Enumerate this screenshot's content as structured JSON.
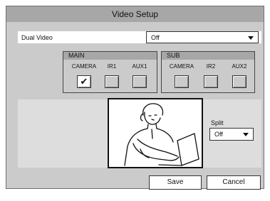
{
  "window": {
    "title": "Video Setup"
  },
  "dual_video": {
    "label": "Dual Video",
    "value": "Off"
  },
  "main_group": {
    "title": "MAIN",
    "channels": [
      {
        "label": "CAMERA",
        "checked": true
      },
      {
        "label": "IR1",
        "checked": false
      },
      {
        "label": "AUX1",
        "checked": false
      }
    ]
  },
  "sub_group": {
    "title": "SUB",
    "channels": [
      {
        "label": "CAMERA",
        "checked": false
      },
      {
        "label": "IR2",
        "checked": false
      },
      {
        "label": "AUX2",
        "checked": false
      }
    ]
  },
  "split": {
    "label": "Split",
    "value": "Off"
  },
  "buttons": {
    "save": "Save",
    "cancel": "Cancel"
  },
  "icons": {
    "dropdown": "chevron-down-icon",
    "check": "checkmark-icon"
  }
}
